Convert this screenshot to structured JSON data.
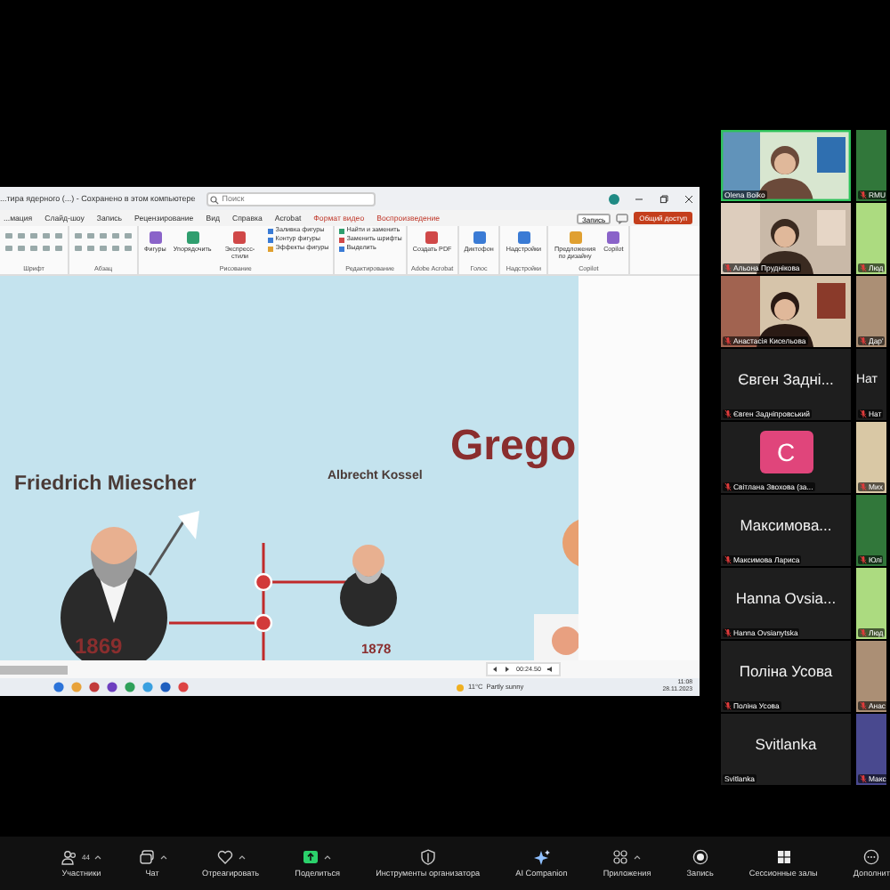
{
  "shared_screen": {
    "document_title": "...тира ядерного (...) - Сохранено в этом компьютере",
    "search_placeholder": "Поиск",
    "ribbon_tabs": [
      {
        "label": "...мация",
        "kind": "normal"
      },
      {
        "label": "Слайд-шоу",
        "kind": "normal"
      },
      {
        "label": "Запись",
        "kind": "normal"
      },
      {
        "label": "Рецензирование",
        "kind": "normal"
      },
      {
        "label": "Вид",
        "kind": "normal"
      },
      {
        "label": "Справка",
        "kind": "normal"
      },
      {
        "label": "Acrobat",
        "kind": "normal"
      },
      {
        "label": "Формат видео",
        "kind": "contextual"
      },
      {
        "label": "Воспроизведение",
        "kind": "contextual"
      }
    ],
    "record_button": "Запись",
    "share_button": "Общий доступ",
    "ribbon_groups": [
      {
        "label": "Шрифт"
      },
      {
        "label": "Абзац"
      },
      {
        "label": "Рисование",
        "commands": [
          {
            "label": "Фигуры",
            "kind": "large"
          },
          {
            "label": "Упорядочить",
            "kind": "large"
          },
          {
            "label": "Экспресс-стили",
            "kind": "large"
          },
          {
            "label": "Заливка фигуры",
            "kind": "small"
          },
          {
            "label": "Контур фигуры",
            "kind": "small"
          },
          {
            "label": "Эффекты фигуры",
            "kind": "small"
          }
        ]
      },
      {
        "label": "Редактирование",
        "commands": [
          {
            "label": "Найти и заменить",
            "kind": "small"
          },
          {
            "label": "Заменить шрифты",
            "kind": "small"
          },
          {
            "label": "Выделить",
            "kind": "small"
          }
        ]
      },
      {
        "label": "Adobe Acrobat",
        "commands": [
          {
            "label": "Создать PDF",
            "kind": "large"
          }
        ]
      },
      {
        "label": "Голос",
        "commands": [
          {
            "label": "Диктофон",
            "kind": "large"
          }
        ]
      },
      {
        "label": "Надстройки",
        "commands": [
          {
            "label": "Надстройки",
            "kind": "large"
          }
        ]
      },
      {
        "label": "Copilot",
        "commands": [
          {
            "label": "Предложения по дизайну",
            "kind": "large"
          },
          {
            "label": "Copilot",
            "kind": "large"
          }
        ]
      }
    ],
    "slide_labels": [
      {
        "text": "Friedrich Miescher",
        "kind": "name"
      },
      {
        "text": "Albrecht Kossel",
        "kind": "name"
      },
      {
        "text": "Grego",
        "kind": "title"
      },
      {
        "text": "1869",
        "kind": "year"
      },
      {
        "text": "1878",
        "kind": "year"
      }
    ],
    "playback_time": "00:24.50",
    "taskbar": {
      "temperature": "11°C",
      "weather": "Partly sunny",
      "time": "11:08",
      "date": "28.11.2023"
    }
  },
  "gallery": {
    "tiles": [
      {
        "kind": "video",
        "label": "Olena Boiko",
        "muted": false,
        "speaking": true
      },
      {
        "kind": "video",
        "label": "RMU",
        "muted": true,
        "speaking": false
      },
      {
        "kind": "video",
        "label": "Альона Пруднікова",
        "muted": true,
        "speaking": false
      },
      {
        "kind": "video",
        "label": "Люд",
        "muted": true,
        "speaking": false
      },
      {
        "kind": "video",
        "label": "Анастасія Кисельова",
        "muted": true,
        "speaking": false
      },
      {
        "kind": "video",
        "label": "Дар'",
        "muted": true,
        "speaking": false
      },
      {
        "kind": "name",
        "display": "Євген Задні...",
        "label": "Євген Задніпровський",
        "muted": true,
        "speaking": false
      },
      {
        "kind": "name",
        "display": "Нат",
        "label": "Нат",
        "muted": true,
        "speaking": false
      },
      {
        "kind": "avatar",
        "display": "С",
        "label": "Світлана Звохова (за...",
        "muted": true,
        "speaking": false
      },
      {
        "kind": "video",
        "label": "Мих",
        "muted": true,
        "speaking": false
      },
      {
        "kind": "name",
        "display": "Максимова...",
        "label": "Максимова Лариса",
        "muted": true,
        "speaking": false
      },
      {
        "kind": "video",
        "label": "Юлі",
        "muted": true,
        "speaking": false
      },
      {
        "kind": "name",
        "display": "Hanna Ovsia...",
        "label": "Hanna Ovsianytska",
        "muted": true,
        "speaking": false
      },
      {
        "kind": "video",
        "label": "Люд",
        "muted": true,
        "speaking": false
      },
      {
        "kind": "name",
        "display": "Поліна Усова",
        "label": "Поліна Усова",
        "muted": true,
        "speaking": false
      },
      {
        "kind": "video",
        "label": "Анас",
        "muted": true,
        "speaking": false
      },
      {
        "kind": "name",
        "display": "Svitlanka",
        "label": "Svitlanka",
        "muted": false,
        "speaking": false
      },
      {
        "kind": "video",
        "label": "Макс",
        "muted": true,
        "speaking": false
      }
    ]
  },
  "toolbar": {
    "items": [
      {
        "kind": "participants",
        "label": "Участники",
        "count": "44",
        "caret": true
      },
      {
        "kind": "chat",
        "label": "Чат",
        "caret": true
      },
      {
        "kind": "react",
        "label": "Отреагировать",
        "caret": true
      },
      {
        "kind": "share",
        "label": "Поделиться",
        "caret": true
      },
      {
        "kind": "host",
        "label": "Инструменты организатора",
        "caret": false
      },
      {
        "kind": "ai",
        "label": "AI Companion",
        "caret": false
      },
      {
        "kind": "apps",
        "label": "Приложения",
        "caret": true
      },
      {
        "kind": "record",
        "label": "Запись",
        "caret": false
      },
      {
        "kind": "rooms",
        "label": "Сессионные залы",
        "caret": false
      },
      {
        "kind": "more",
        "label": "Дополнит",
        "caret": false
      }
    ]
  }
}
